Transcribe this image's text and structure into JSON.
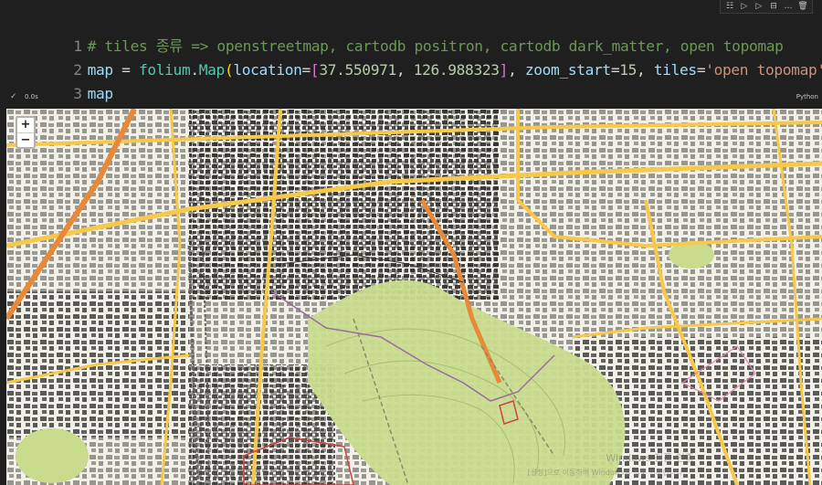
{
  "toolbar": {
    "icons": [
      "split-cell-icon",
      "run-above-icon",
      "run-below-icon",
      "split-icon",
      "more-icon",
      "delete-icon"
    ],
    "glyphs": [
      "☷",
      "▷",
      "▷",
      "⊟",
      "…",
      "🗑"
    ]
  },
  "code": {
    "line_numbers": [
      "1",
      "2",
      "3"
    ],
    "line1": {
      "comment": "# tiles 종류 => openstreetmap, cartodb positron, cartodb dark_matter, open topomap"
    },
    "line2": {
      "var": "map",
      "eq": " = ",
      "module": "folium",
      "dot": ".",
      "fn": "Map",
      "open_paren": "(",
      "param1": "location",
      "eq1": "=",
      "open_bracket": "[",
      "lat": "37.550971",
      "comma1": ", ",
      "lon": "126.988323",
      "close_bracket": "]",
      "comma2": ", ",
      "param2": "zoom_start",
      "eq2": "=",
      "zoom": "15",
      "comma3": ", ",
      "param3": "tiles",
      "eq3": "=",
      "tiles": "'open topomap'",
      "close_paren": ")"
    },
    "line3": {
      "var": "map"
    }
  },
  "status": {
    "check": "✓",
    "time": "0.0s",
    "language": "Python"
  },
  "map": {
    "zoom_in": "+",
    "zoom_out": "−",
    "watermark": "Windows 정품 인증",
    "watermark_sub": "[설정]으로 이동하여 Windows를 정품 인증합니다.",
    "colors": {
      "background": "#f2f0e6",
      "park": "#c9dc8e",
      "road_major": "#f7c94a",
      "road_orange": "#e8893a",
      "building": "#2a2a2a"
    }
  }
}
